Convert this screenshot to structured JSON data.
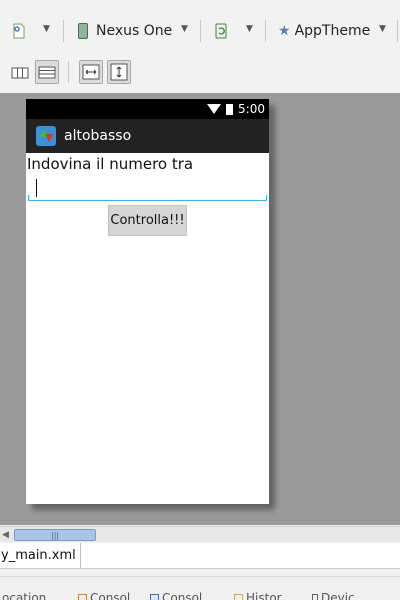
{
  "toolbar": {
    "device_label": "Nexus One",
    "theme_label": "AppTheme"
  },
  "device_screen": {
    "status_time": "5:00",
    "app_title": "altobasso",
    "prompt_text": "Indovina il numero tra",
    "input_value": "",
    "button_label": "Controlla!!!"
  },
  "editor_tab": {
    "label": "y_main.xml"
  },
  "bottom_tabs": [
    {
      "label": "ocation"
    },
    {
      "label": "Consol"
    },
    {
      "label": "Consol"
    },
    {
      "label": "Histor"
    },
    {
      "label": "Devic"
    }
  ],
  "colors": {
    "canvas_bg": "#9a9a9a",
    "input_underline": "#33b5e5",
    "action_bar": "#222222",
    "scroll_thumb": "#a9c4e6"
  },
  "icons": [
    "file-icon",
    "device-icon",
    "rotate-icon",
    "star-icon",
    "layout-columns-icon",
    "layout-rows-icon",
    "fit-width-icon",
    "fit-height-icon",
    "wifi-icon",
    "battery-icon",
    "app-icon"
  ]
}
